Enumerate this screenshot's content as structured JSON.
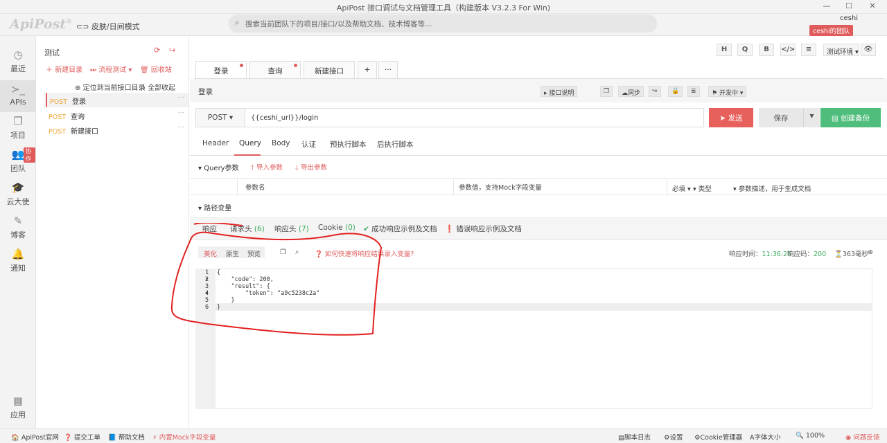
{
  "window": {
    "title": "ApiPost 接口调试与文档管理工具（构建版本 V3.2.3 For Win)"
  },
  "topbar": {
    "logo": "ApiPost",
    "logo_mark": "®",
    "skin_label": "皮肤/日间模式",
    "search_placeholder": "搜索当前团队下的项目/接口/以及帮助文档、技术博客等...",
    "user_name": "ceshi",
    "team_label": "ceshi的团队"
  },
  "leftnav": {
    "items": [
      {
        "label": "最近",
        "icon": "clock-icon"
      },
      {
        "label": "APIs",
        "icon": "terminal-icon"
      },
      {
        "label": "项目",
        "icon": "project-icon"
      },
      {
        "label": "团队",
        "icon": "team-icon"
      },
      {
        "label": "云大使",
        "icon": "cap-icon"
      },
      {
        "label": "博客",
        "icon": "edit-icon"
      },
      {
        "label": "通知",
        "icon": "bell-icon"
      },
      {
        "label": "应用",
        "icon": "grid-icon"
      }
    ],
    "team_badge": "协作"
  },
  "tree": {
    "project_name": "测试",
    "actions": {
      "new_dir": "新建目录",
      "flow_test": "流程测试",
      "recycle": "回收站"
    },
    "locate": "定位到当前接口目录",
    "collapse": "全部收起",
    "items": [
      {
        "method": "POST",
        "name": "登录"
      },
      {
        "method": "POST",
        "name": "查询"
      },
      {
        "method": "POST",
        "name": "新建接口"
      }
    ]
  },
  "toolbar": {
    "buttons": [
      "H",
      "Q",
      "B",
      "</>",
      "≡"
    ],
    "env": "测试环境",
    "env_arrow": "▾",
    "eye": "👁"
  },
  "tabs": [
    {
      "label": "登录",
      "dot": true
    },
    {
      "label": "查询",
      "dot": true
    },
    {
      "label": "新建接口",
      "dot": false
    }
  ],
  "tab_add": "+",
  "tab_more": "···",
  "request": {
    "name": "登录",
    "desc_btn": "接口说明",
    "sync_btn": "同步",
    "status_btn": "开发中",
    "method": "POST",
    "url": "{{ceshi_url}}/login",
    "send": "发送",
    "save": "保存",
    "backup": "创建备份"
  },
  "req_tabs": [
    "Header",
    "Query",
    "Body",
    "认证",
    "预执行脚本",
    "后执行脚本"
  ],
  "query": {
    "section": "Query参数",
    "import": "导入参数",
    "export": "导出参数",
    "col_name": "参数名",
    "col_value": "参数值，支持Mock字段变量",
    "col_required": "必填",
    "col_type": "类型",
    "col_desc": "参数描述，用于生成文档"
  },
  "path_section": "路径变量",
  "response": {
    "tabs": {
      "resp": "响应",
      "req_header": "请求头",
      "req_header_count": "(6)",
      "resp_header": "响应头",
      "resp_header_count": "(7)",
      "cookie": "Cookie",
      "cookie_count": "(0)",
      "success_example": "成功响应示例及文档",
      "error_example": "错误响应示例及文档"
    },
    "subtabs": [
      "美化",
      "原生",
      "预览"
    ],
    "help": "如何快速将响应结果录入变量?",
    "time_label": "响应时间：",
    "time_value": "11:36:25",
    "code_label": "响应码：",
    "code_value": "200",
    "duration": "363毫秒",
    "body_lines": [
      "{",
      "    \"code\": 200,",
      "    \"result\": {",
      "        \"token\": \"a9c5238c2a\"",
      "    }",
      "}"
    ],
    "line_numbers": [
      "1",
      "2",
      "3",
      "4",
      "5",
      "6"
    ]
  },
  "statusbar": {
    "site": "ApiPost官网",
    "ticket": "提交工单",
    "docs": "帮助文档",
    "mock": "内置Mock字段变量",
    "script_log": "脚本日志",
    "settings": "设置",
    "cookie_mgr": "Cookie管理器",
    "font_size": "字体大小",
    "zoom": "100%",
    "feedback": "问题反馈"
  },
  "colors": {
    "accent": "#e05c5c",
    "green": "#4fbd7b",
    "method": "#f0a63a"
  }
}
